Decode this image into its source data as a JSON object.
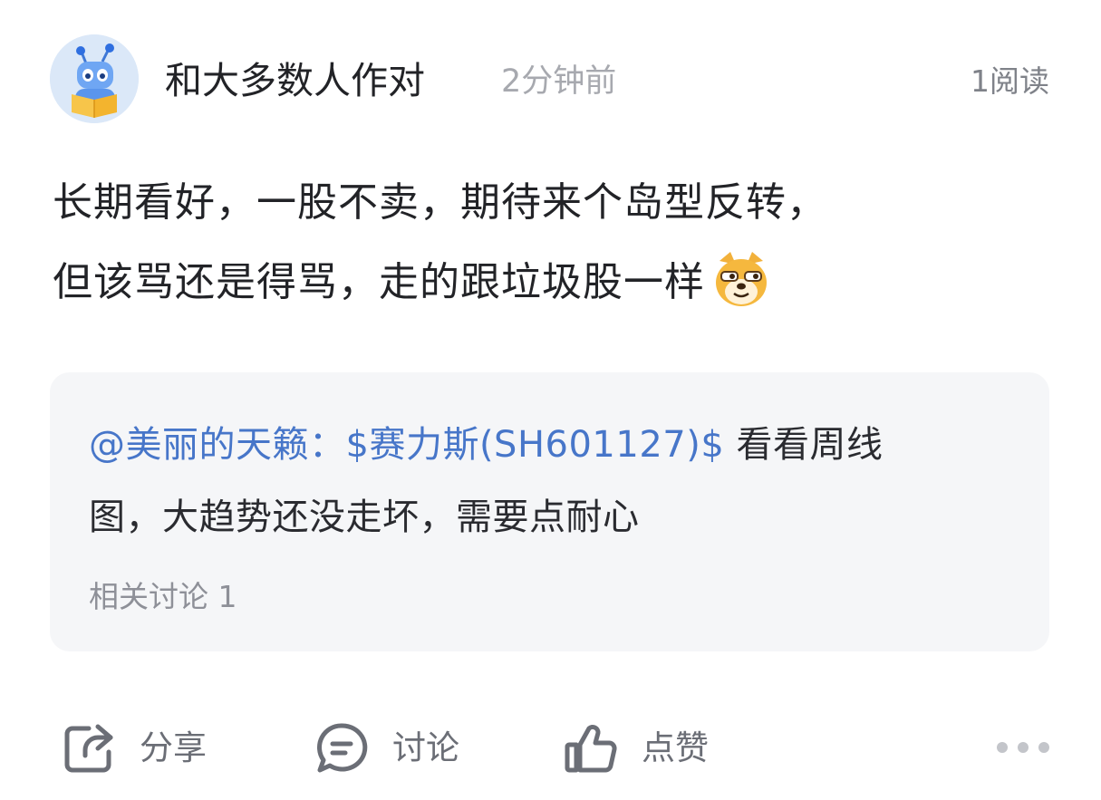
{
  "post": {
    "author": "和大多数人作对",
    "time": "2分钟前",
    "read_count": "1阅读",
    "body_line1": "长期看好，一股不卖，期待来个岛型反转，",
    "body_line2": "但该骂还是得骂，走的跟垃圾股一样",
    "emoji": "doge-emoji"
  },
  "quote": {
    "mention": "@美丽的天籁：",
    "stock_tag": "$赛力斯(SH601127)$",
    "text_after_tag": " 看看周线",
    "text_line2": "图，大趋势还没走坏，需要点耐心",
    "related_discussions": "相关讨论 1"
  },
  "actions": {
    "share_label": "分享",
    "comment_label": "讨论",
    "like_label": "点赞"
  },
  "colors": {
    "link": "#4776c9",
    "secondary_text": "#a7a9af",
    "card_bg": "#f5f6f8",
    "icon_gray": "#6b6e76"
  },
  "icons": {
    "avatar": "robot-reading-book-avatar",
    "share": "share-icon",
    "comment": "comment-bubble-icon",
    "like": "thumbs-up-icon",
    "more": "more-dots-icon"
  }
}
